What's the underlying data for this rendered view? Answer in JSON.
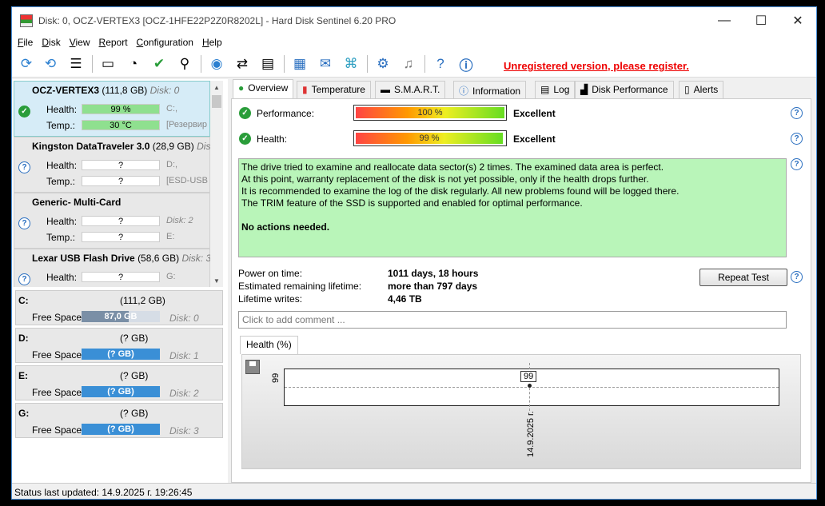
{
  "window": {
    "title": "Disk: 0, OCZ-VERTEX3 [OCZ-1HFE22P2Z0R8202L]  -  Hard Disk Sentinel 6.20 PRO",
    "minimize": "—",
    "maximize": "☐",
    "close": "✕"
  },
  "menu": [
    {
      "ul": "F",
      "rest": "ile"
    },
    {
      "ul": "D",
      "rest": "isk"
    },
    {
      "ul": "V",
      "rest": "iew"
    },
    {
      "ul": "R",
      "rest": "eport"
    },
    {
      "ul": "C",
      "rest": "onfiguration"
    },
    {
      "ul": "H",
      "rest": "elp"
    }
  ],
  "toolbar": {
    "register_text": "Unregistered version, please register.",
    "icons": [
      "refresh-icon",
      "refresh-all-icon",
      "disk-list-icon",
      "disk-test-icon",
      "disk-timer-icon",
      "disk-check-icon",
      "disk-search-icon",
      "globe-disk-icon",
      "disk-transfer-icon",
      "disk-save-icon",
      "notes-icon",
      "mail-icon",
      "network-icon",
      "gear-icon",
      "sound-icon",
      "help-icon",
      "info-icon"
    ]
  },
  "disks": [
    {
      "name": "OCZ-VERTEX3",
      "capacity": "(111,8 GB)",
      "disk_no": "Disk: 0",
      "health_label": "Health:",
      "health": "99 %",
      "health_extra": "C:,",
      "temp_label": "Temp.:",
      "temp": "30 °C",
      "temp_extra": "[Резервир",
      "status": "ok"
    },
    {
      "name": "Kingston DataTraveler 3.0",
      "capacity": "(28,9 GB)",
      "disk_no": "Disk",
      "health_label": "Health:",
      "health": "?",
      "health_extra": "D:,",
      "temp_label": "Temp.:",
      "temp": "?",
      "temp_extra": "[ESD-USB",
      "status": "unknown"
    },
    {
      "name": "Generic- Multi-Card",
      "capacity": "",
      "disk_no": "",
      "health_label": "Health:",
      "health": "?",
      "health_extra": "Disk: 2",
      "temp_label": "Temp.:",
      "temp": "?",
      "temp_extra": "E:",
      "status": "unknown"
    },
    {
      "name": "Lexar  USB Flash Drive",
      "capacity": "(58,6 GB)",
      "disk_no": "Disk: 3",
      "health_label": "Health:",
      "health": "?",
      "health_extra": "G:",
      "temp_label": "",
      "temp": "",
      "temp_extra": "",
      "status": "unknown"
    }
  ],
  "partitions": [
    {
      "letter": "C:",
      "capacity": "(111,2 GB)",
      "label": "Free Space",
      "free": "87,0 GB",
      "disk": "Disk: 0"
    },
    {
      "letter": "D:",
      "capacity": "(? GB)",
      "label": "Free Space",
      "free": "(? GB)",
      "disk": "Disk: 1"
    },
    {
      "letter": "E:",
      "capacity": "(? GB)",
      "label": "Free Space",
      "free": "(? GB)",
      "disk": "Disk: 2"
    },
    {
      "letter": "G:",
      "capacity": "(? GB)",
      "label": "Free Space",
      "free": "(? GB)",
      "disk": "Disk: 3"
    }
  ],
  "tabs": [
    "Overview",
    "Temperature",
    "S.M.A.R.T.",
    "Information",
    "Log",
    "Disk Performance",
    "Alerts"
  ],
  "overview": {
    "performance_label": "Performance:",
    "performance_value": "100 %",
    "performance_fill": 1.0,
    "performance_word": "Excellent",
    "health_label": "Health:",
    "health_value": "99 %",
    "health_fill": 0.99,
    "health_word": "Excellent",
    "messages": [
      "The drive tried to examine and reallocate data sector(s) 2 times. The examined data area is perfect.",
      "At this point, warranty replacement of the disk is not yet possible, only if the health drops further.",
      "It is recommended to examine the log of the disk regularly. All new problems found will be logged there.",
      "The TRIM feature of the SSD is supported and enabled for optimal performance."
    ],
    "conclusion": "No actions needed.",
    "power_on_label": "Power on time:",
    "power_on_value": "1011 days, 18 hours",
    "lifetime_label": "Estimated remaining lifetime:",
    "lifetime_value": "more than 797 days",
    "writes_label": "Lifetime writes:",
    "writes_value": "4,46 TB",
    "repeat_button": "Repeat Test",
    "comment_placeholder": "Click to add comment ...",
    "graph_tab": "Health (%)",
    "graph_y": "99",
    "graph_point": "99",
    "graph_x": "14.9.2025 г."
  },
  "status": "Status last updated: 14.9.2025 г. 19:26:45"
}
